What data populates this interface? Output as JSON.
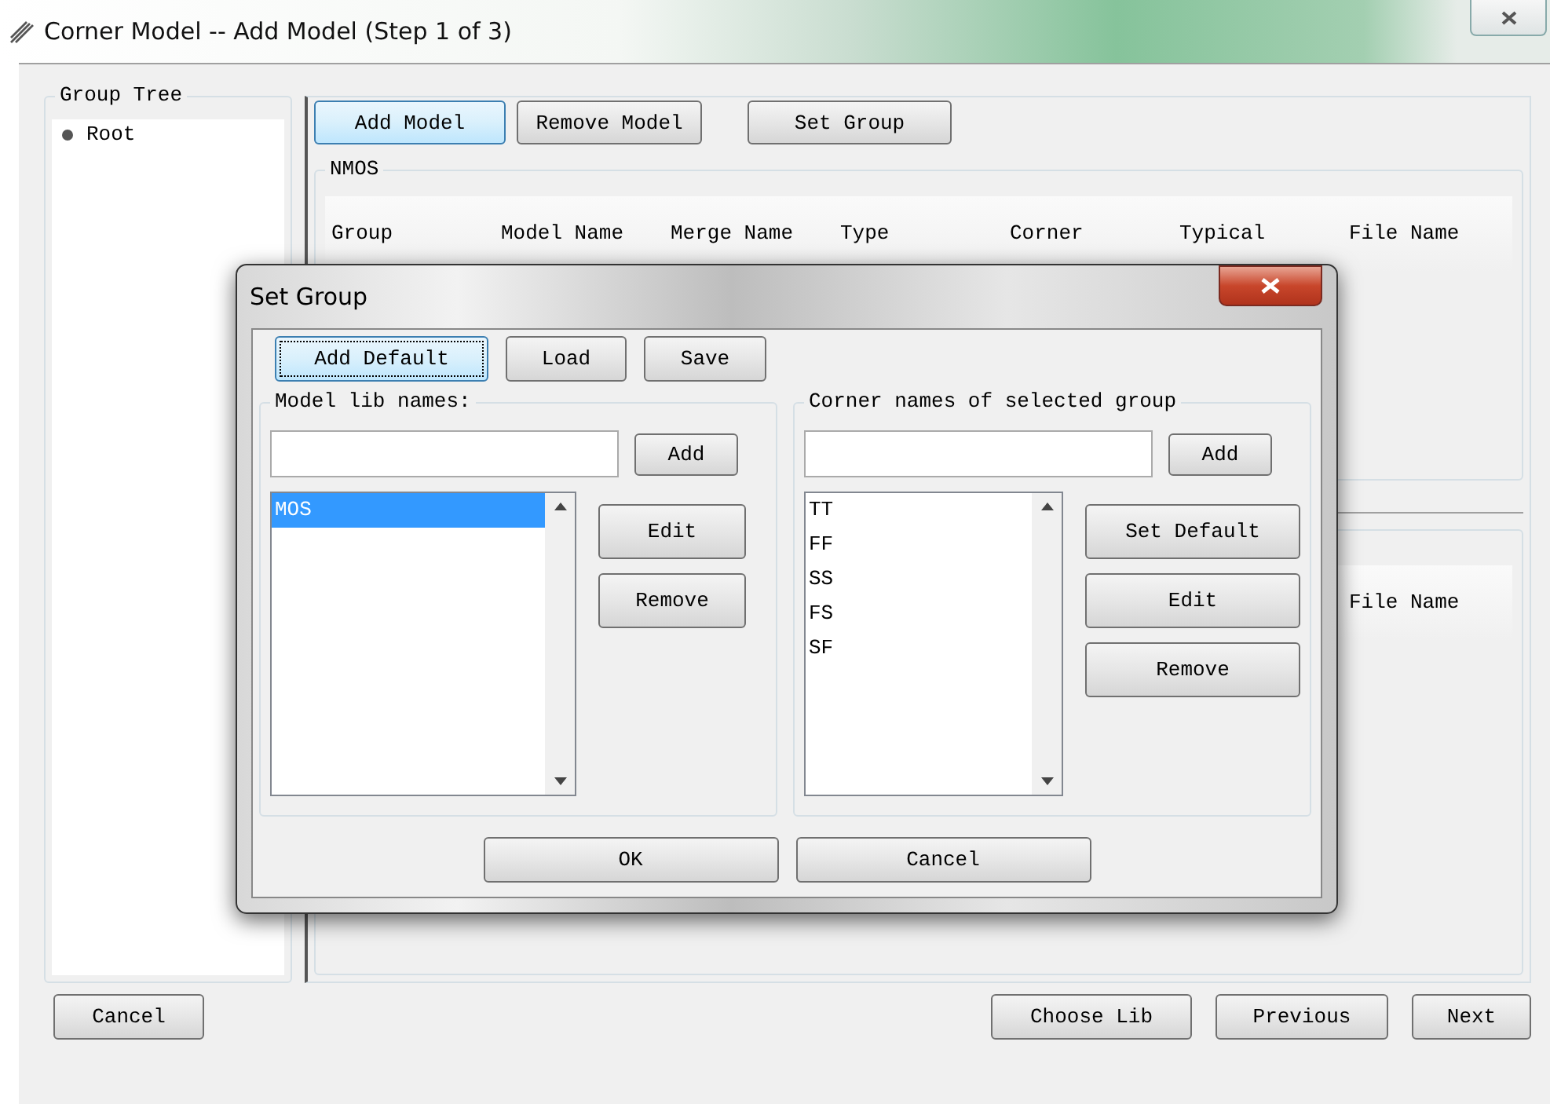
{
  "window": {
    "title": "Corner Model -- Add Model (Step 1 of 3)"
  },
  "group_tree": {
    "title": "Group Tree",
    "items": [
      {
        "label": "Root"
      }
    ]
  },
  "toolbar": [
    {
      "label": "Add Model",
      "selected": true
    },
    {
      "label": "Remove Model",
      "selected": false
    },
    {
      "label": "Set Group",
      "selected": false
    }
  ],
  "nmos_group": {
    "title": "NMOS",
    "columns": [
      "Group",
      "Model Name",
      "Merge Name",
      "Type",
      "Corner",
      "Typical",
      "File Name"
    ]
  },
  "second_group": {
    "columns": [
      "File Name"
    ]
  },
  "footer_buttons": {
    "left": [
      "Cancel"
    ],
    "right": [
      "Choose Lib",
      "Previous",
      "Next"
    ]
  },
  "dialog": {
    "title": "Set Group",
    "buttons": [
      {
        "label": "Add Default",
        "focused": true
      },
      {
        "label": "Load",
        "focused": false
      },
      {
        "label": "Save",
        "focused": false
      }
    ],
    "model_lib": {
      "title": "Model lib names:",
      "add_button": "Add",
      "items": [
        {
          "label": "MOS",
          "selected": true
        }
      ],
      "buttons": [
        "Edit",
        "Remove"
      ]
    },
    "corner_names": {
      "title": "Corner names of selected group",
      "add_button": "Add",
      "items": [
        {
          "label": "TT",
          "selected": false
        },
        {
          "label": "FF",
          "selected": false
        },
        {
          "label": "SS",
          "selected": false
        },
        {
          "label": "FS",
          "selected": false
        },
        {
          "label": "SF",
          "selected": false
        }
      ],
      "buttons": [
        "Set Default",
        "Edit",
        "Remove"
      ]
    },
    "footer": [
      "OK",
      "Cancel"
    ]
  }
}
